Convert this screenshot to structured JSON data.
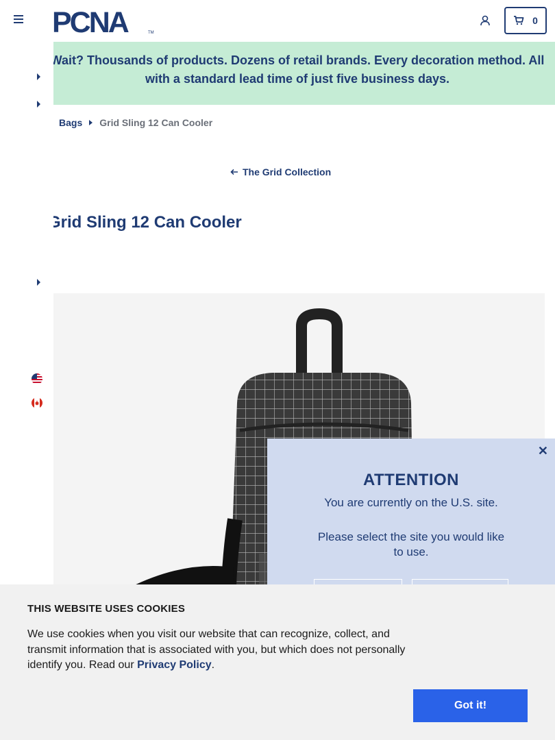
{
  "header": {
    "logo_text": "PCNA",
    "logo_tm": "TM",
    "cart_count": "0"
  },
  "promo": {
    "text": "Wait? Thousands of products. Dozens of retail brands. Every decoration method. All with a standard lead time of just five business days."
  },
  "breadcrumb": {
    "parent": "Bags",
    "current": "Grid Sling 12 Can Cooler"
  },
  "collection_link": "The Grid Collection",
  "product": {
    "title": "Grid Sling 12 Can Cooler"
  },
  "site_modal": {
    "title": "ATTENTION",
    "message": "You are currently on the U.S. site.",
    "prompt": "Please select the site you would like to use."
  },
  "cookie": {
    "title": "THIS WEBSITE USES COOKIES",
    "text_before": "We use cookies when you visit our website that can recognize, collect, and transmit information that is associated with you, but which does not personally identify you. Read our ",
    "link": "Privacy Policy",
    "text_after": ".",
    "button": "Got it!"
  },
  "colors": {
    "navy": "#1f3b73",
    "promo_bg": "#c5ecd5",
    "modal_bg": "#d0daef",
    "cookie_btn": "#2a62e8"
  }
}
